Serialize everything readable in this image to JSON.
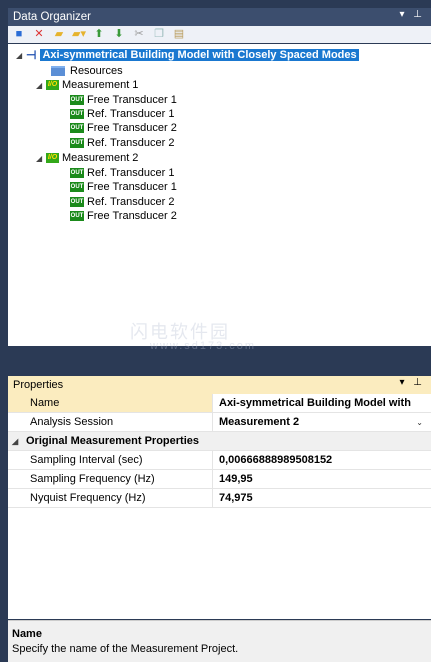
{
  "data_organizer": {
    "title": "Data Organizer",
    "window_controls": "▾ ⊥",
    "toolbar": [
      "new-item-icon",
      "delete-icon",
      "open-folder-icon",
      "folder-dropdown-icon",
      "move-up-icon",
      "move-down-icon",
      "cut-icon",
      "copy-icon",
      "paste-icon"
    ],
    "tree": {
      "root": "Axi-symmetrical Building Model with Closely Spaced Modes",
      "resources": "Resources",
      "measurements": [
        {
          "label": "Measurement 1",
          "children": [
            "Free Transducer 1",
            "Ref. Transducer 1",
            "Free Transducer 2",
            "Ref. Transducer 2"
          ]
        },
        {
          "label": "Measurement 2",
          "children": [
            "Ref. Transducer 1",
            "Free Transducer 1",
            "Ref. Transducer 2",
            "Free Transducer 2"
          ]
        }
      ],
      "badge_io": "I/O",
      "badge_out": "OUT"
    }
  },
  "properties": {
    "title": "Properties",
    "window_controls": "▾ ⊥",
    "rows": {
      "name_key": "Name",
      "name_val": "Axi-symmetrical Building Model with",
      "session_key": "Analysis Session",
      "session_val": "Measurement 2",
      "category": "Original Measurement Properties",
      "interval_key": "Sampling Interval (sec)",
      "interval_val": "0,00666888989508152",
      "freq_key": "Sampling Frequency (Hz)",
      "freq_val": "149,95",
      "nyq_key": "Nyquist Frequency (Hz)",
      "nyq_val": "74,975"
    },
    "description_title": "Name",
    "description_text": "Specify the name of the Measurement Project."
  },
  "watermark": {
    "line1": "闪电软件园",
    "line2": "www.sd173.com"
  },
  "colors": {
    "chrome": "#2b3a55",
    "selection": "#1a78d0",
    "highlight": "#fbecbf",
    "io_badge": "#33a81a"
  }
}
